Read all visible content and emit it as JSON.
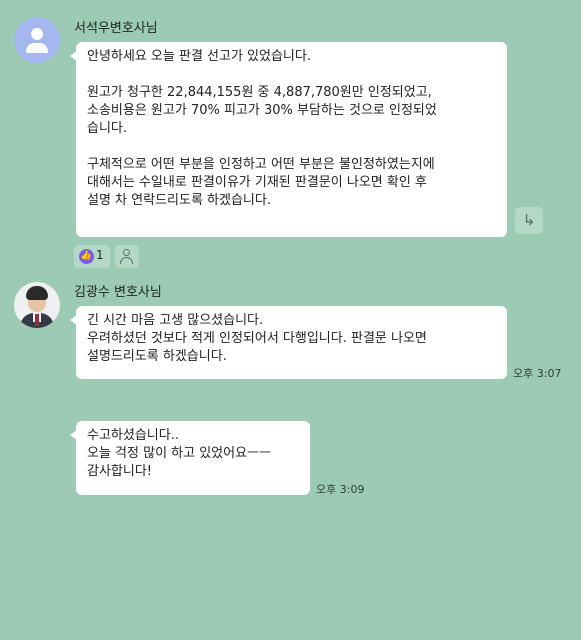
{
  "messages": [
    {
      "sender": "서석우변호사님",
      "avatar": "default-person-icon",
      "text": "안녕하세요 오늘 판결 선고가 있었습니다.\n\n원고가 청구한 22,844,155원 중 4,887,780원만 인정되었고,\n소송비용은 원고가 70% 피고가 30% 부담하는 것으로 인정되었\n습니다.\n\n구체적으로 어떤 부분을 인정하고 어떤 부분은 불인정하였는지에\n 대해서는 수일내로 판결이유가 기재된 판결문이 나오면 확인 후\n설명 차 연락드리도록 하겠습니다.",
      "time": "",
      "reactions": {
        "like_icon": "thumbs-up-icon",
        "like_count": "1",
        "add_icon": "add-reaction-person-icon"
      },
      "reply_icon": "reply-arrow-icon"
    },
    {
      "sender": "김광수 변호사님",
      "avatar": "profile-photo",
      "text": "긴 시간 마음 고생 많으셨습니다.\n우려하셨던 것보다 적게 인정되어서 다행입니다. 판결문 나오면\n설명드리도록 하겠습니다.",
      "time": "오후 3:07"
    },
    {
      "sender": "",
      "text": "수고하셨습니다..\n오늘 걱정 많이 하고 있었어요ㅡㅡ\n감사합니다!",
      "time": "오후 3:09"
    }
  ],
  "colors": {
    "background": "#9ccab4",
    "bubble": "#ffffff",
    "reaction_bg": "#b4d8c7",
    "like_badge": "#7a5ce0",
    "default_avatar": "#a4b8ef"
  }
}
